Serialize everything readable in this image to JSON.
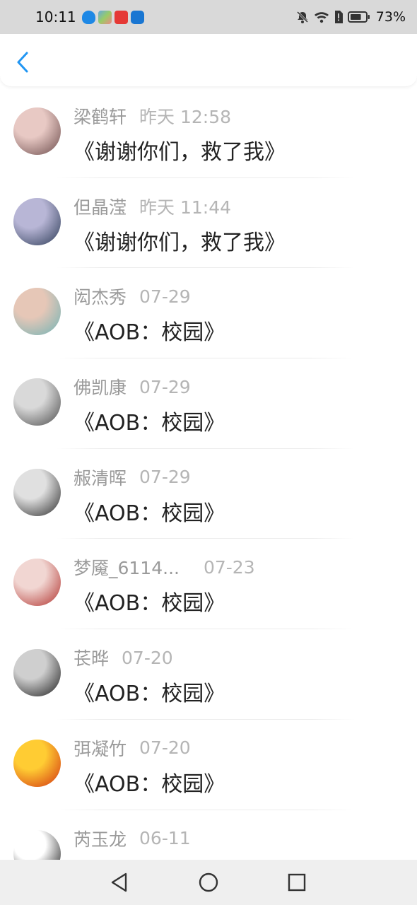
{
  "status_bar": {
    "time": "10:11",
    "battery_percent": "73%",
    "battery_level": 0.73,
    "app_icons": [
      "shield-app-icon",
      "photo-app-icon",
      "red-app-icon",
      "bulb-app-icon"
    ]
  },
  "header": {
    "back_icon": "chevron-left-icon",
    "accent_color": "#2196f3"
  },
  "comments": [
    {
      "name": "梁鹤轩",
      "time": "昨天 12:58",
      "message": "《谢谢你们，救了我》",
      "avatar_colors": [
        "#e8c9c4",
        "#6b4b4b"
      ]
    },
    {
      "name": "但晶滢",
      "time": "昨天 11:44",
      "message": "《谢谢你们，救了我》",
      "avatar_colors": [
        "#b8b6d6",
        "#2b3a55"
      ]
    },
    {
      "name": "闳杰秀",
      "time": "07-29",
      "message": "《AOB：校园》",
      "avatar_colors": [
        "#e6c7b7",
        "#6fb3b6"
      ]
    },
    {
      "name": "佛凯康",
      "time": "07-29",
      "message": "《AOB：校园》",
      "avatar_colors": [
        "#d9d9d9",
        "#4a4a4a"
      ]
    },
    {
      "name": "赧清晖",
      "time": "07-29",
      "message": "《AOB：校园》",
      "avatar_colors": [
        "#e0e0e0",
        "#2a2a2a"
      ]
    },
    {
      "name": "梦魇_6114...",
      "time": "07-23",
      "message": "《AOB：校园》",
      "avatar_colors": [
        "#f1d6d2",
        "#b0302c"
      ]
    },
    {
      "name": "苌晔",
      "time": "07-20",
      "message": "《AOB：校园》",
      "avatar_colors": [
        "#cfcfcf",
        "#1c1c1c"
      ]
    },
    {
      "name": "弭凝竹",
      "time": "07-20",
      "message": "《AOB：校园》",
      "avatar_colors": [
        "#ffcc33",
        "#d2300f"
      ]
    },
    {
      "name": "芮玉龙",
      "time": "06-11",
      "message": "",
      "avatar_colors": [
        "#ffffff",
        "#111111"
      ]
    }
  ],
  "nav_bar": {
    "back_icon": "triangle-back-icon",
    "home_icon": "circle-home-icon",
    "recents_icon": "square-recents-icon"
  }
}
